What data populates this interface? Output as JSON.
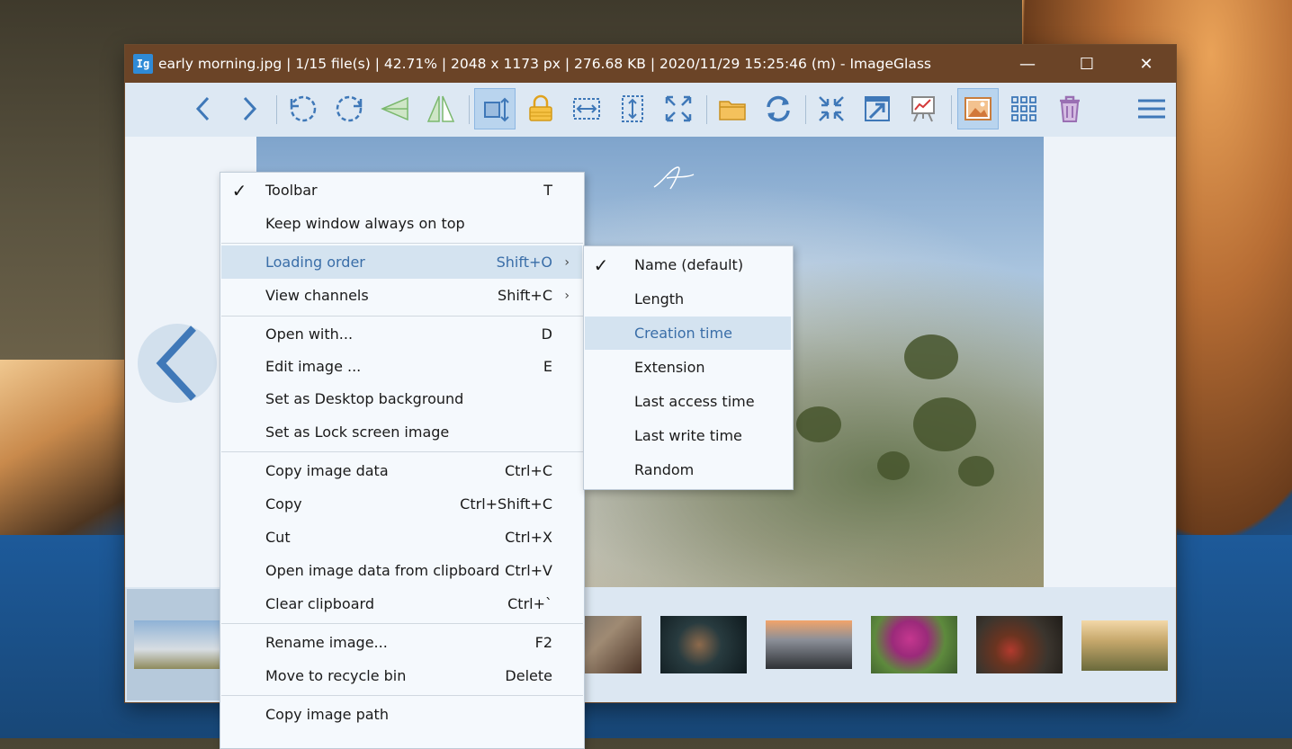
{
  "window": {
    "title": "early morning.jpg  |  1/15 file(s)  |  42.71%  |  2048 x 1173 px  |  276.68 KB  |  2020/11/29 15:25:46 (m)  - ImageGlass",
    "app_icon_text": "Ig",
    "minimize_glyph": "—",
    "maximize_glyph": "☐",
    "close_glyph": "✕"
  },
  "toolbar": {
    "buttons": [
      "previous-image",
      "next-image",
      "rotate-left",
      "rotate-right",
      "flip-horizontal",
      "flip-vertical",
      "auto-zoom",
      "lock-zoom",
      "scale-to-width",
      "scale-to-height",
      "scale-to-fit",
      "open-file",
      "refresh",
      "fullscreen-collapse",
      "go-to-image",
      "slideshow",
      "show-thumbnails",
      "thumbnail-grid",
      "delete",
      "main-menu"
    ],
    "active": [
      "auto-zoom",
      "show-thumbnails"
    ],
    "accent_color": "#3f78b8"
  },
  "context_menu": {
    "items": [
      {
        "label": "Toolbar",
        "shortcut": "T",
        "checked": true
      },
      {
        "label": "Keep window always on top",
        "shortcut": ""
      },
      {
        "label": "Loading order",
        "shortcut": "Shift+O",
        "submenu": true,
        "highlighted": true
      },
      {
        "label": "View channels",
        "shortcut": "Shift+C",
        "submenu": true
      },
      {
        "label": "Open with...",
        "shortcut": "D"
      },
      {
        "label": "Edit image ...",
        "shortcut": "E"
      },
      {
        "label": "Set as Desktop background",
        "shortcut": ""
      },
      {
        "label": "Set as Lock screen image",
        "shortcut": ""
      },
      {
        "label": "Copy image data",
        "shortcut": "Ctrl+C"
      },
      {
        "label": "Copy",
        "shortcut": "Ctrl+Shift+C"
      },
      {
        "label": "Cut",
        "shortcut": "Ctrl+X"
      },
      {
        "label": "Open image data from clipboard",
        "shortcut": "Ctrl+V"
      },
      {
        "label": "Clear clipboard",
        "shortcut": "Ctrl+`"
      },
      {
        "label": "Rename image...",
        "shortcut": "F2"
      },
      {
        "label": "Move to recycle bin",
        "shortcut": "Delete"
      },
      {
        "label": "Copy image path",
        "shortcut": ""
      }
    ],
    "check_glyph": "✓",
    "submenu_arrow": "›"
  },
  "loading_order_submenu": {
    "items": [
      {
        "label": "Name (default)",
        "checked": true
      },
      {
        "label": "Length"
      },
      {
        "label": "Creation time",
        "highlighted": true
      },
      {
        "label": "Extension"
      },
      {
        "label": "Last access time"
      },
      {
        "label": "Last write time"
      },
      {
        "label": "Random"
      }
    ]
  },
  "thumbnails": {
    "count_visible": 8,
    "selected_index": 0
  },
  "colors": {
    "titlebar": "#6b4427",
    "menu_highlight": "#d4e3f0",
    "menu_highlight_text": "#3a6ea8"
  }
}
